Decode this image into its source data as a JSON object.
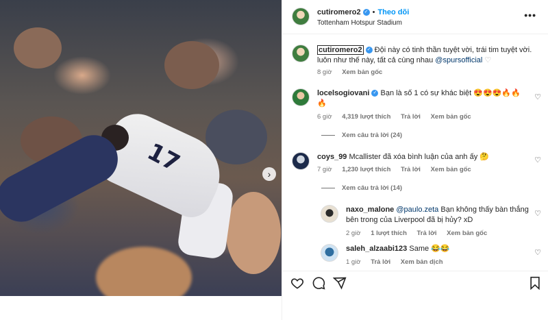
{
  "post": {
    "username": "cutiromero2",
    "follow_label": "Theo dõi",
    "location": "Tottenham Hotspur Stadium",
    "more_label": "•••",
    "verified_glyph": "✓",
    "next_arrow": "›",
    "shirt_number": "17"
  },
  "caption": {
    "username": "cutiromero2",
    "text": "Đội này có tinh thần tuyệt vời, trái tim tuyệt vời. luôn như thế này, tất cả cùng nhau",
    "mention": "@spursofficial",
    "heart": "♡",
    "time": "8 giờ",
    "see_original": "Xem bản gốc"
  },
  "comments": [
    {
      "username": "locelsogiovani",
      "verified": true,
      "text": "Bạn là số 1 có sự khác biệt 😍😍😍🔥🔥",
      "text_line2": "🔥",
      "time": "6 giờ",
      "likes": "4,319 lượt thích",
      "reply": "Trả lời",
      "see_original": "Xem bản gốc",
      "view_replies": "Xem câu trả lời (24)"
    },
    {
      "username": "coys_99",
      "text": "Mcallister đã xóa bình luận của anh ấy 🤔",
      "time": "7 giờ",
      "likes": "1,230 lượt thích",
      "reply": "Trả lời",
      "see_original": "Xem bản gốc",
      "view_replies": "Xem câu trả lời (14)"
    }
  ],
  "replies": [
    {
      "username": "naxo_malone",
      "mention": "@paulo.zeta",
      "text": "Bạn không thấy bàn thắng bên trong của Liverpool đã bị hủy? xD",
      "time": "2 giờ",
      "likes": "1 lượt thích",
      "reply": "Trả lời",
      "see_original": "Xem bản gốc"
    },
    {
      "username": "saleh_alzaabi123",
      "text": "Same 😂😂",
      "time": "1 giờ",
      "reply": "Trả lời",
      "see_translation": "Xem bản dịch"
    }
  ],
  "icons": {
    "heart": "heart-icon",
    "comment": "comment-icon",
    "share": "share-icon",
    "save": "bookmark-icon"
  },
  "colors": {
    "accent": "#0095f6",
    "verified": "#3897f0",
    "text": "#262626",
    "muted": "#737373"
  }
}
